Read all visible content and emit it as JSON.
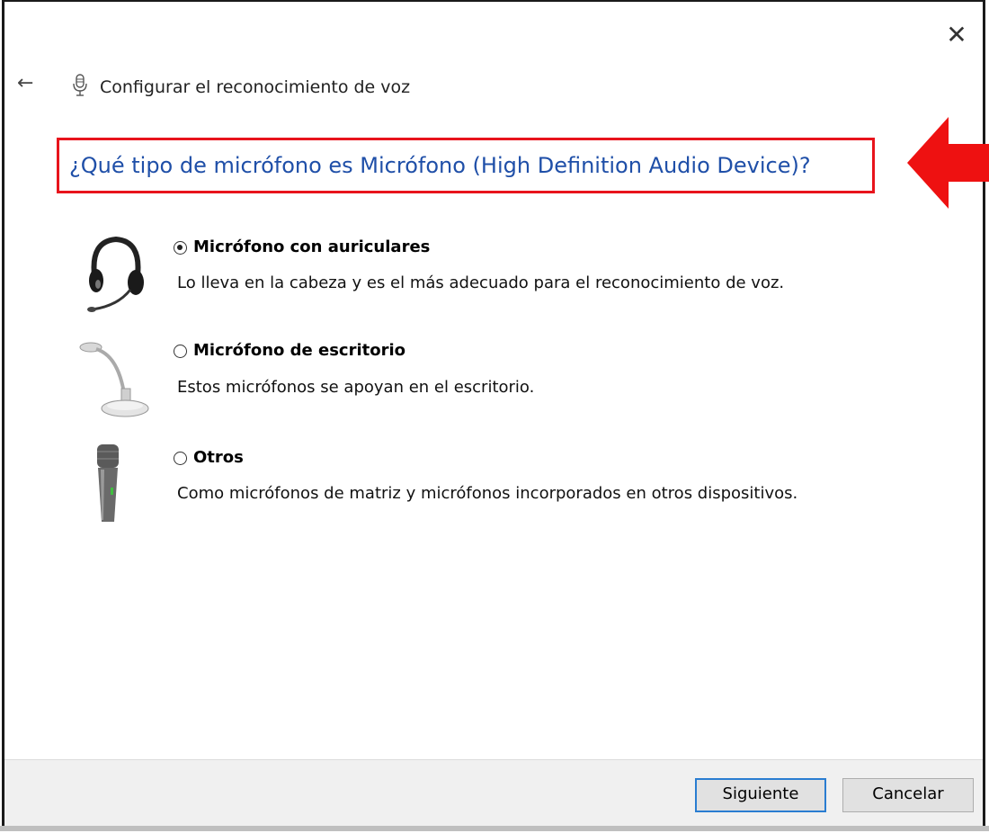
{
  "window": {
    "title": "Configurar el reconocimiento de voz",
    "close_glyph": "✕",
    "back_glyph": "←"
  },
  "heading": "¿Qué tipo de micrófono es Micrófono (High Definition Audio Device)?",
  "options": [
    {
      "label": "Micrófono con auriculares",
      "description": "Lo lleva en la cabeza y es el más adecuado para el reconocimiento de voz.",
      "checked": true,
      "icon": "headset-icon"
    },
    {
      "label": "Micrófono de escritorio",
      "description": "Estos micrófonos se apoyan en el escritorio.",
      "checked": false,
      "icon": "desktop-microphone-icon"
    },
    {
      "label": "Otros",
      "description": "Como micrófonos de matriz y micrófonos incorporados en otros dispositivos.",
      "checked": false,
      "icon": "handheld-microphone-icon"
    }
  ],
  "buttons": {
    "next": "Siguiente",
    "cancel": "Cancelar"
  },
  "colors": {
    "heading": "#1f4fa8",
    "highlight": "#e8141c",
    "accent": "#2a7dd1"
  }
}
